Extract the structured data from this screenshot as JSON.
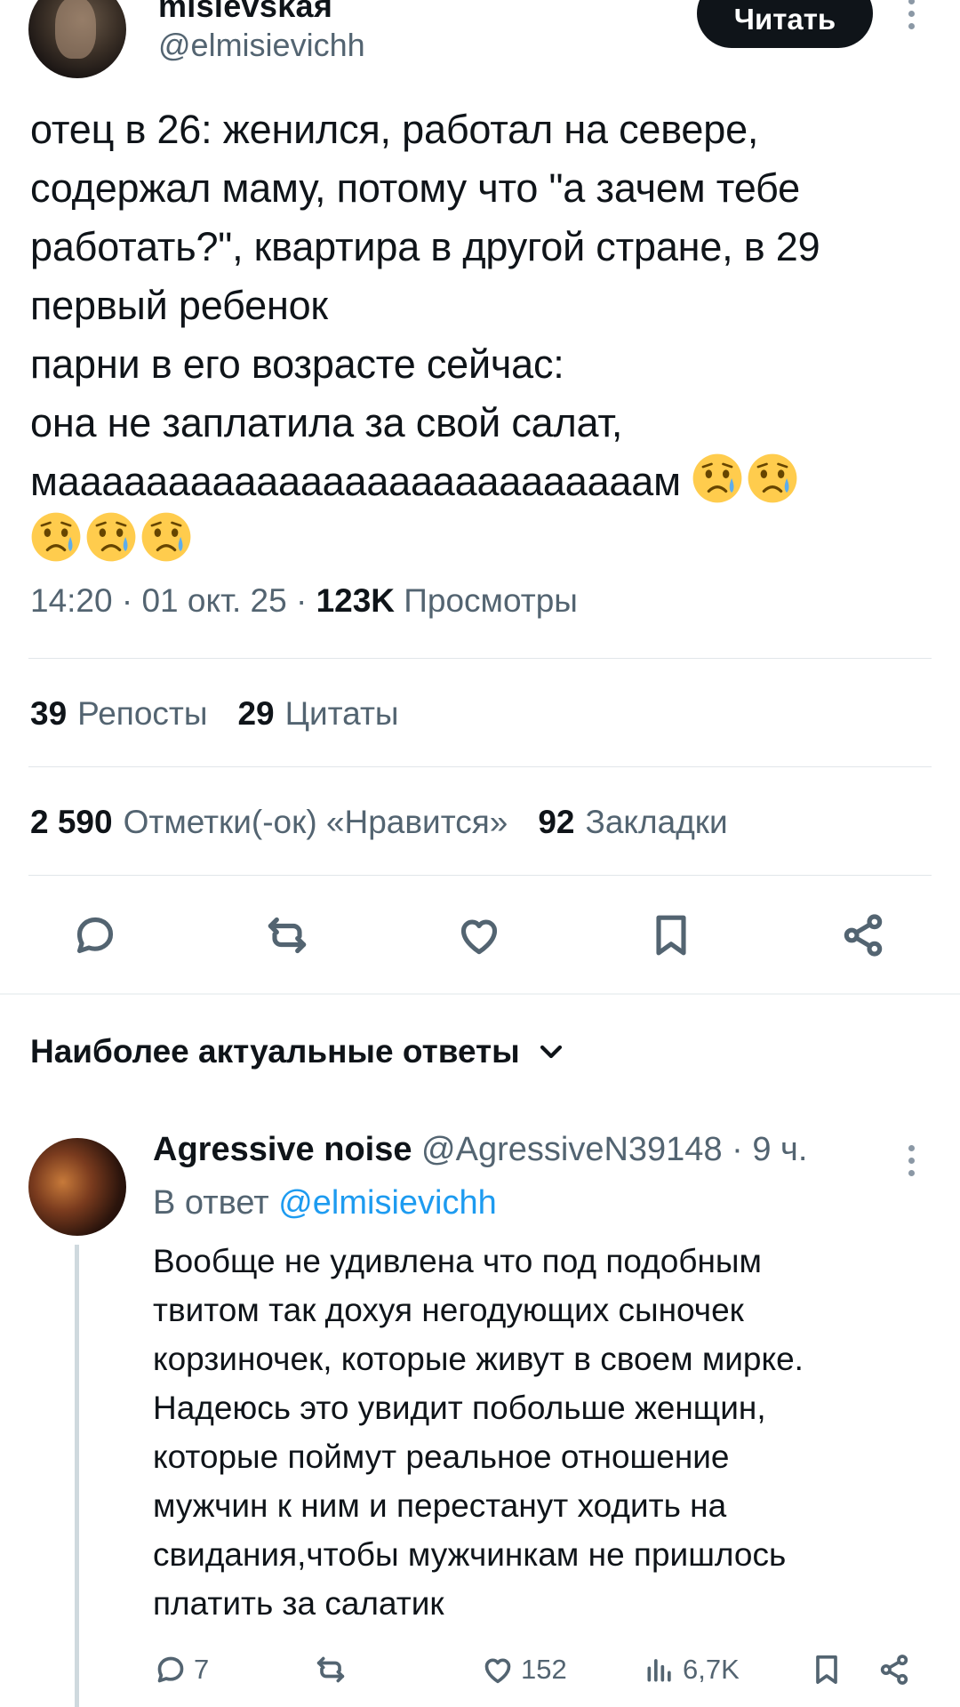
{
  "post": {
    "author": {
      "display_name": "misievskaя",
      "handle": "@elmisievichh"
    },
    "follow_label": "Читать",
    "text": "отец в 26: женился, работал на севере,\nсодержал маму, потому что \"а зачем тебе\nработать?\", квартира в другой стране, в 29\nпервый ребенок\nпарни в его возрасте сейчас:\nона не заплатила за свой салат,\nмааааааааааааааааааааааааааам",
    "emojis": [
      "sad-but-relieved-face",
      "sad-but-relieved-face",
      "sad-but-relieved-face",
      "sad-but-relieved-face",
      "sad-but-relieved-face"
    ],
    "time": "14:20",
    "date": "01 окт. 25",
    "views_count": "123K",
    "views_label": "Просмотры",
    "separator": "·"
  },
  "stats": {
    "reposts": {
      "count": "39",
      "label": "Репосты"
    },
    "quotes": {
      "count": "29",
      "label": "Цитаты"
    },
    "likes": {
      "count": "2 590",
      "label": "Отметки(-ок) «Нравится»"
    },
    "bookmarks": {
      "count": "92",
      "label": "Закладки"
    }
  },
  "actions": [
    "reply-icon",
    "repost-icon",
    "like-icon",
    "bookmark-icon",
    "share-icon"
  ],
  "replies_section": {
    "title": "Наиболее актуальные ответы"
  },
  "reply": {
    "display_name": "Agressive noise",
    "handle": "@AgressiveN39148",
    "separator": "·",
    "time": "9 ч.",
    "reply_prefix": "В ответ",
    "reply_mention": "@elmisievichh",
    "text": "Вообще не удивлена что под подобным\nтвитом так дохуя негодующих сыночек\nкорзиночек, которые живут в своем мирке.\nНадеюсь это увидит побольше женщин,\nкоторые поймут реальное отношение\nмужчин к ним и перестанут ходить на\nсвидания,чтобы мужчинкам не пришлось\nплатить за салатик",
    "reply_count": "7",
    "like_count": "152",
    "view_count": "6,7K"
  },
  "colors": {
    "text": "#0f1419",
    "muted": "#536471",
    "link": "#1d9bf0",
    "divider": "#e1e6ea"
  }
}
